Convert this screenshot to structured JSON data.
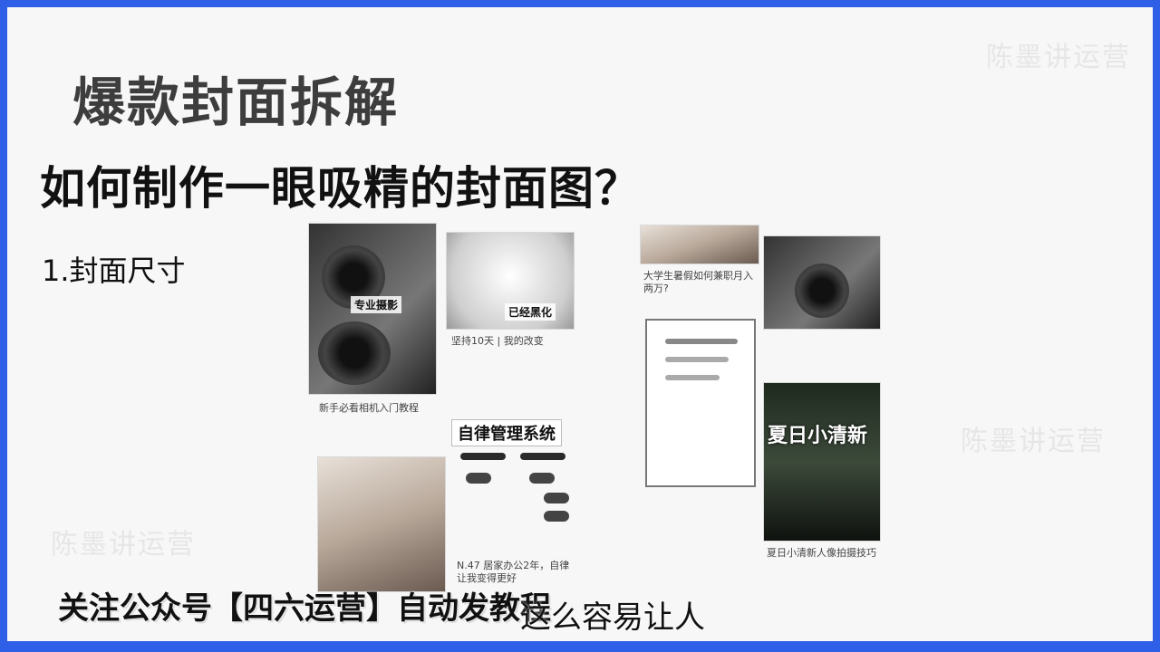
{
  "slide": {
    "title": "爆款封面拆解",
    "subtitle": "如何制作一眼吸精的封面图？",
    "section": "1.封面尺寸"
  },
  "watermark": "陈墨讲运营",
  "collage": {
    "cards": [
      {
        "tag": "专业摄影",
        "caption": "新手必看相机入门教程"
      },
      {
        "tag": "已经黑化",
        "caption": "坚持10天 | 我的改变"
      },
      {
        "caption": "大学生暑假如何兼职月入两万?"
      },
      {
        "tag": "夏日小清新",
        "caption": "夏日小清新人像拍摄技巧"
      },
      {
        "doc_title": "自律管理系统",
        "caption": "N.47 居家办公2年，自律让我变得更好"
      }
    ]
  },
  "subtitles": {
    "promo": "关注公众号【四六运营】自动发教程",
    "caption": "这么容易让人"
  }
}
